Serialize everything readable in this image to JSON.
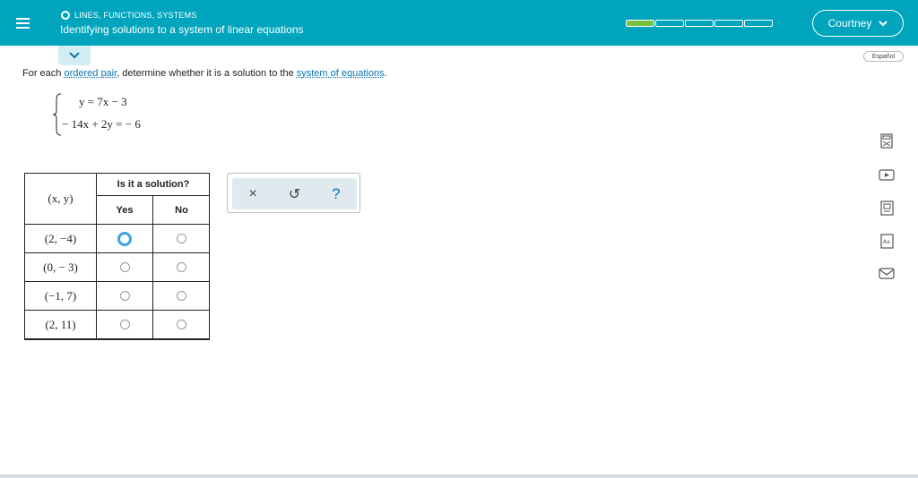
{
  "header": {
    "topic": "LINES, FUNCTIONS, SYSTEMS",
    "lesson_title": "Identifying solutions to a system of linear equations",
    "progress": {
      "segments": 5,
      "filled": 1
    },
    "user_name": "Courtney",
    "colors": {
      "bar": "#00a5bd",
      "progress_fill": "#7ac142"
    }
  },
  "language_toggle": "Español",
  "prompt": {
    "before": "For each ",
    "link1": "ordered pair",
    "middle": ", determine whether it is a solution to the ",
    "link2": "system of equations",
    "after": "."
  },
  "system": {
    "eq1": "y = 7x − 3",
    "eq2": "− 14x + 2y = − 6"
  },
  "table": {
    "header_question": "Is it a solution?",
    "header_xy": "(x, y)",
    "col_yes": "Yes",
    "col_no": "No",
    "rows": [
      {
        "pair": "(2, −4)",
        "focused": "yes"
      },
      {
        "pair": "(0, − 3)",
        "focused": ""
      },
      {
        "pair": "(−1, 7)",
        "focused": ""
      },
      {
        "pair": "(2, 11)",
        "focused": ""
      }
    ]
  },
  "tools": {
    "clear": "×",
    "undo": "↺",
    "help": "?"
  },
  "side_icons": [
    "calculator-icon",
    "video-icon",
    "textbook-icon",
    "dictionary-icon",
    "mail-icon"
  ]
}
